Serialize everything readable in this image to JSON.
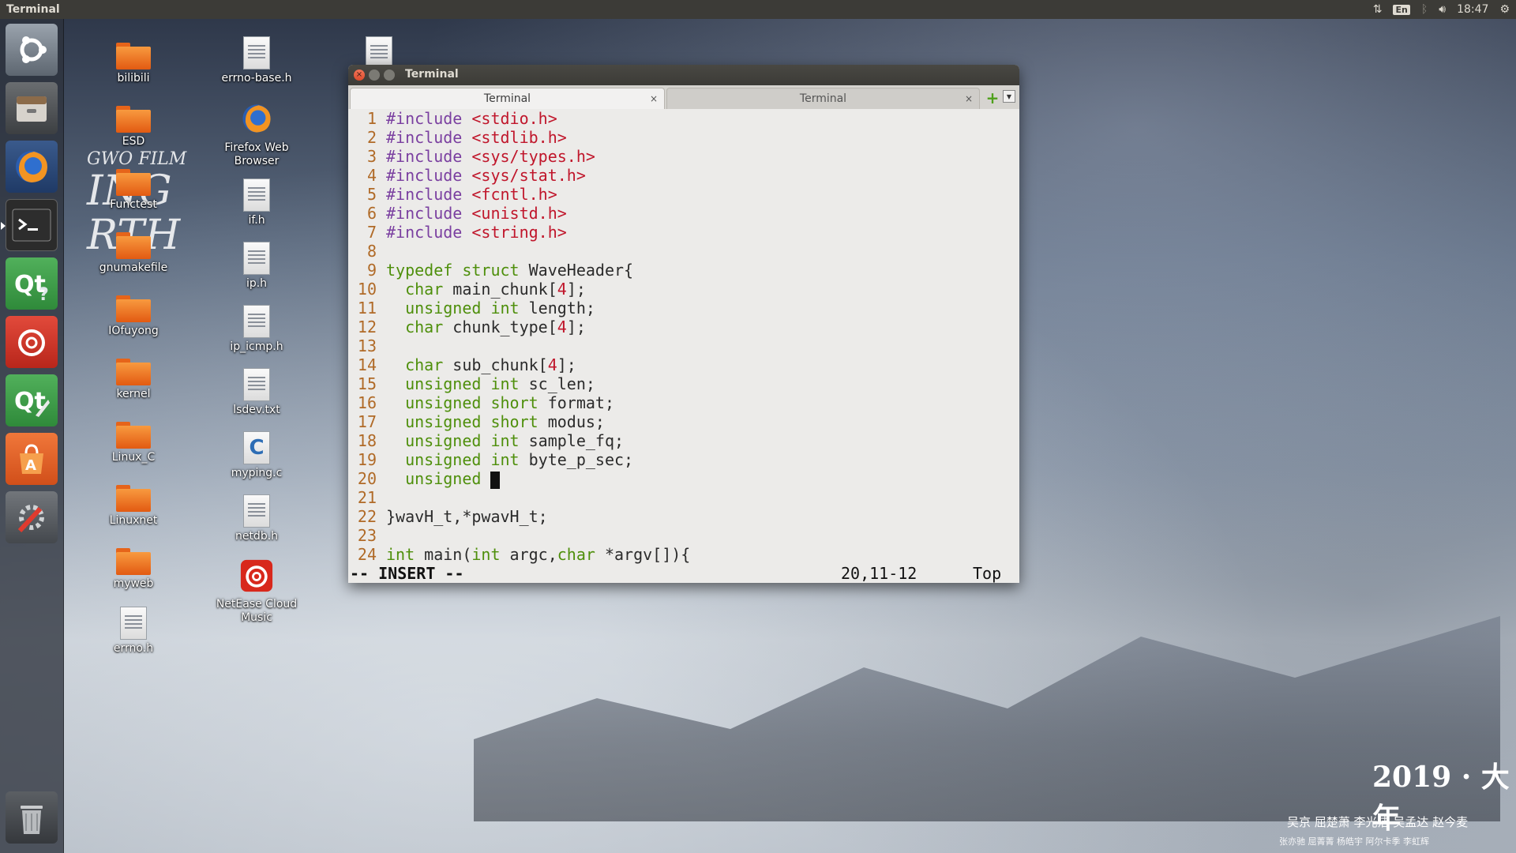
{
  "top_panel": {
    "app_title": "Terminal",
    "keyboard_lang": "En",
    "clock": "18:47"
  },
  "launcher": {
    "items": [
      {
        "name": "ubuntu-dash",
        "icon": "ubuntu-logo-icon"
      },
      {
        "name": "files",
        "icon": "file-cabinet-icon"
      },
      {
        "name": "firefox",
        "icon": "firefox-icon"
      },
      {
        "name": "terminal",
        "icon": "terminal-icon",
        "active": true
      },
      {
        "name": "qt-assistant",
        "icon": "qt-assistant-icon"
      },
      {
        "name": "netease-cloud-music",
        "icon": "netease-music-icon"
      },
      {
        "name": "qt-designer",
        "icon": "qt-designer-icon"
      },
      {
        "name": "ubuntu-software",
        "icon": "software-bag-icon"
      },
      {
        "name": "system-settings",
        "icon": "settings-wrench-icon"
      },
      {
        "name": "trash",
        "icon": "trash-icon"
      }
    ]
  },
  "desktop": {
    "col1": [
      "bilibili",
      "ESD",
      "Functest",
      "gnumakefile",
      "IOfuyong",
      "kernel",
      "Linux_C",
      "Linuxnet",
      "myweb",
      "errno.h"
    ],
    "col2": [
      "errno-base.h",
      "Firefox Web Browser",
      "if.h",
      "ip.h",
      "ip_icmp.h",
      "lsdev.txt",
      "myping.c",
      "netdb.h",
      "NetEase Cloud Music"
    ],
    "col3": [
      ""
    ]
  },
  "wallpaper": {
    "poster_left_en": [
      "GWO FILM",
      "ING",
      "RTH"
    ],
    "poster_year": "2019 · 大年",
    "poster_cast_1": "吴京   屈楚萧  李光洁  吴孟达  赵今麦",
    "poster_cast_2": "张亦驰  屈菁菁  杨皓宇  阿尔卡季  李虹辉"
  },
  "terminal": {
    "title": "Terminal",
    "tabs": [
      {
        "label": "Terminal",
        "close": "×",
        "active": true
      },
      {
        "label": "Terminal",
        "close": "×",
        "active": false
      }
    ],
    "add_tab": "+",
    "menu_caret": "▼",
    "lines": [
      {
        "n": "1",
        "parts": [
          {
            "c": "pp",
            "t": "#include "
          },
          {
            "c": "str",
            "t": "<stdio.h>"
          }
        ]
      },
      {
        "n": "2",
        "parts": [
          {
            "c": "pp",
            "t": "#include "
          },
          {
            "c": "str",
            "t": "<stdlib.h>"
          }
        ]
      },
      {
        "n": "3",
        "parts": [
          {
            "c": "pp",
            "t": "#include "
          },
          {
            "c": "str",
            "t": "<sys/types.h>"
          }
        ]
      },
      {
        "n": "4",
        "parts": [
          {
            "c": "pp",
            "t": "#include "
          },
          {
            "c": "str",
            "t": "<sys/stat.h>"
          }
        ]
      },
      {
        "n": "5",
        "parts": [
          {
            "c": "pp",
            "t": "#include "
          },
          {
            "c": "str",
            "t": "<fcntl.h>"
          }
        ]
      },
      {
        "n": "6",
        "parts": [
          {
            "c": "pp",
            "t": "#include "
          },
          {
            "c": "str",
            "t": "<unistd.h>"
          }
        ]
      },
      {
        "n": "7",
        "parts": [
          {
            "c": "pp",
            "t": "#include "
          },
          {
            "c": "str",
            "t": "<string.h>"
          }
        ]
      },
      {
        "n": "8",
        "parts": []
      },
      {
        "n": "9",
        "parts": [
          {
            "c": "type",
            "t": "typedef struct "
          },
          {
            "c": "",
            "t": "WaveHeader{"
          }
        ]
      },
      {
        "n": "10",
        "parts": [
          {
            "c": "",
            "t": "  "
          },
          {
            "c": "type",
            "t": "char"
          },
          {
            "c": "",
            "t": " main_chunk["
          },
          {
            "c": "num",
            "t": "4"
          },
          {
            "c": "",
            "t": "];"
          }
        ]
      },
      {
        "n": "11",
        "parts": [
          {
            "c": "",
            "t": "  "
          },
          {
            "c": "type",
            "t": "unsigned int"
          },
          {
            "c": "",
            "t": " length;"
          }
        ]
      },
      {
        "n": "12",
        "parts": [
          {
            "c": "",
            "t": "  "
          },
          {
            "c": "type",
            "t": "char"
          },
          {
            "c": "",
            "t": " chunk_type["
          },
          {
            "c": "num",
            "t": "4"
          },
          {
            "c": "",
            "t": "];"
          }
        ]
      },
      {
        "n": "13",
        "parts": []
      },
      {
        "n": "14",
        "parts": [
          {
            "c": "",
            "t": "  "
          },
          {
            "c": "type",
            "t": "char"
          },
          {
            "c": "",
            "t": " sub_chunk["
          },
          {
            "c": "num",
            "t": "4"
          },
          {
            "c": "",
            "t": "];"
          }
        ]
      },
      {
        "n": "15",
        "parts": [
          {
            "c": "",
            "t": "  "
          },
          {
            "c": "type",
            "t": "unsigned int"
          },
          {
            "c": "",
            "t": " sc_len;"
          }
        ]
      },
      {
        "n": "16",
        "parts": [
          {
            "c": "",
            "t": "  "
          },
          {
            "c": "type",
            "t": "unsigned short"
          },
          {
            "c": "",
            "t": " format;"
          }
        ]
      },
      {
        "n": "17",
        "parts": [
          {
            "c": "",
            "t": "  "
          },
          {
            "c": "type",
            "t": "unsigned short"
          },
          {
            "c": "",
            "t": " modus;"
          }
        ]
      },
      {
        "n": "18",
        "parts": [
          {
            "c": "",
            "t": "  "
          },
          {
            "c": "type",
            "t": "unsigned int"
          },
          {
            "c": "",
            "t": " sample_fq;"
          }
        ]
      },
      {
        "n": "19",
        "parts": [
          {
            "c": "",
            "t": "  "
          },
          {
            "c": "type",
            "t": "unsigned int"
          },
          {
            "c": "",
            "t": " byte_p_sec;"
          }
        ]
      },
      {
        "n": "20",
        "parts": [
          {
            "c": "",
            "t": "  "
          },
          {
            "c": "type",
            "t": "unsigned"
          },
          {
            "c": "",
            "t": " "
          }
        ],
        "cursor": true
      },
      {
        "n": "21",
        "parts": []
      },
      {
        "n": "22",
        "parts": [
          {
            "c": "",
            "t": "}wavH_t,*pwavH_t;"
          }
        ]
      },
      {
        "n": "23",
        "parts": []
      },
      {
        "n": "24",
        "parts": [
          {
            "c": "type",
            "t": "int"
          },
          {
            "c": "",
            "t": " main("
          },
          {
            "c": "type",
            "t": "int"
          },
          {
            "c": "",
            "t": " argc,"
          },
          {
            "c": "type",
            "t": "char"
          },
          {
            "c": "",
            "t": " *argv[]){"
          }
        ]
      }
    ],
    "status": {
      "mode": "-- INSERT --",
      "position": "20,11-12",
      "scroll": "Top"
    }
  },
  "colors": {
    "panel": "#3c3b37",
    "terminal_bg": "#ecebe9",
    "line_number": "#b06a27",
    "preproc": "#7a3fa0",
    "string": "#c0162b",
    "type": "#4e8f0b"
  }
}
